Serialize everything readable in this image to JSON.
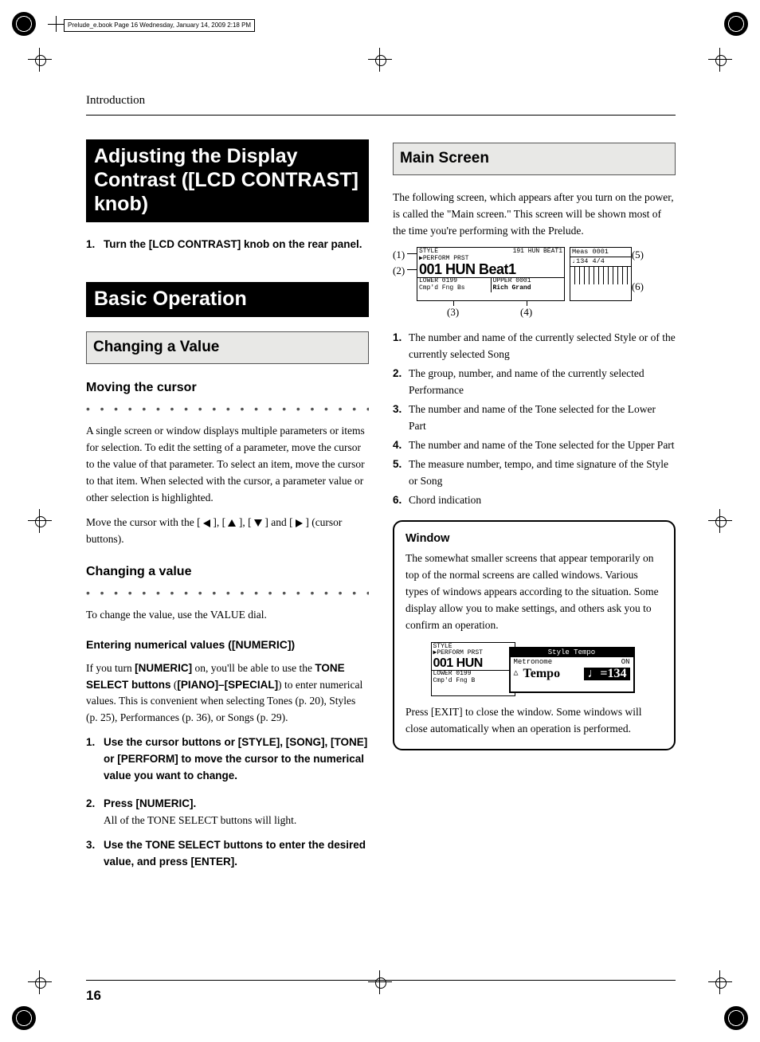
{
  "crop_header": "Prelude_e.book  Page 16  Wednesday, January 14, 2009  2:18 PM",
  "chapter": "Introduction",
  "page_number": "16",
  "left": {
    "heading1": "Adjusting the Display Contrast ([LCD CONTRAST] knob)",
    "step1_num": "1.",
    "step1_text": "Turn the [LCD CONTRAST] knob on the rear panel.",
    "heading2": "Basic Operation",
    "sub1": "Changing a Value",
    "h_cursor": "Moving the cursor",
    "cursor_para": "A single screen or window displays multiple parameters or items for selection. To edit the setting of a parameter, move the cursor to the value of that parameter. To select an item, move the cursor to that item. When selected with the cursor, a parameter value or other selection is highlighted.",
    "cursor_move_pre": "Move the cursor with the [ ",
    "cursor_move_comma": " ], [ ",
    "cursor_move_and": " ] and [ ",
    "cursor_move_end": " ] (cursor buttons).",
    "h_change": "Changing a value",
    "change_para": "To change the value, use the VALUE dial.",
    "sub_bold": "Entering numerical values ([NUMERIC])",
    "numeric_para_pre": "If you turn ",
    "numeric_on": "[NUMERIC]",
    "numeric_para_mid1": " on, you'll be able to use the ",
    "tone_select": "TONE SELECT buttons",
    "numeric_para_mid2": " (",
    "piano_special": "[PIANO]–[SPECIAL]",
    "numeric_para_tail": ") to enter numerical values. This is convenient when selecting Tones (p. 20), Styles (p. 25), Performances (p. 36), or Songs (p. 29).",
    "ns1_num": "1.",
    "ns1_text": "Use the cursor buttons or [STYLE], [SONG], [TONE] or [PERFORM] to move the cursor to the numerical value you want to change.",
    "ns2_num": "2.",
    "ns2_text": "Press [NUMERIC].",
    "ns2_tail": "All of the TONE SELECT buttons will light.",
    "ns3_num": "3.",
    "ns3_text": "Use the TONE SELECT buttons to enter the desired value, and press [ENTER]."
  },
  "right": {
    "heading": "Main Screen",
    "para1": "The following screen, which appears after you turn on the power, is called the \"Main screen.\" This screen will be shown most of the time you're performing with the Prelude.",
    "lcd": {
      "top_left": "STYLE",
      "top_right": "191 HUN BEAT1",
      "perform": "▶PERFORM PRST",
      "title": "001 HUN Beat1",
      "lower_l_lbl": "LOWER  0199",
      "lower_l_val": "Cmp'd Fng Bs",
      "upper_l_lbl": "UPPER  0001",
      "upper_l_val": "Rich Grand",
      "meas": "Meas  0001",
      "tempo": "♩134  4/4"
    },
    "callouts": {
      "c1": "(1)",
      "c2": "(2)",
      "c3": "(3)",
      "c4": "(4)",
      "c5": "(5)",
      "c6": "(6)"
    },
    "list": [
      "The number and name of the currently selected Style or of the currently selected Song",
      "The group, number, and name of the currently selected Performance",
      "The number and name of the Tone selected for the Lower Part",
      "The number and name of the Tone selected for the Upper Part",
      "The measure number, tempo, and time signature of the Style or Song",
      "Chord indication"
    ],
    "list_nums": [
      "1.",
      "2.",
      "3.",
      "4.",
      "5.",
      "6."
    ],
    "window": {
      "title": "Window",
      "para1": "The somewhat smaller screens that appear temporarily on top of the normal screens are called windows. Various types of windows appears according to the situation. Some display allow you to make settings, and others ask you to confirm an operation.",
      "lcd": {
        "style": "STYLE",
        "perform": "▶PERFORM PRST",
        "big": "001 HUN",
        "lower": "LOWER  0199",
        "lower2": "Cmp'd Fng B",
        "popup_title": "Style Tempo",
        "metro": "Metronome",
        "on": "ON",
        "tempo_lbl": "Tempo",
        "tempo_val": "♩=134"
      },
      "para2": "Press [EXIT] to close the window. Some windows will close automatically when an operation is performed."
    }
  }
}
